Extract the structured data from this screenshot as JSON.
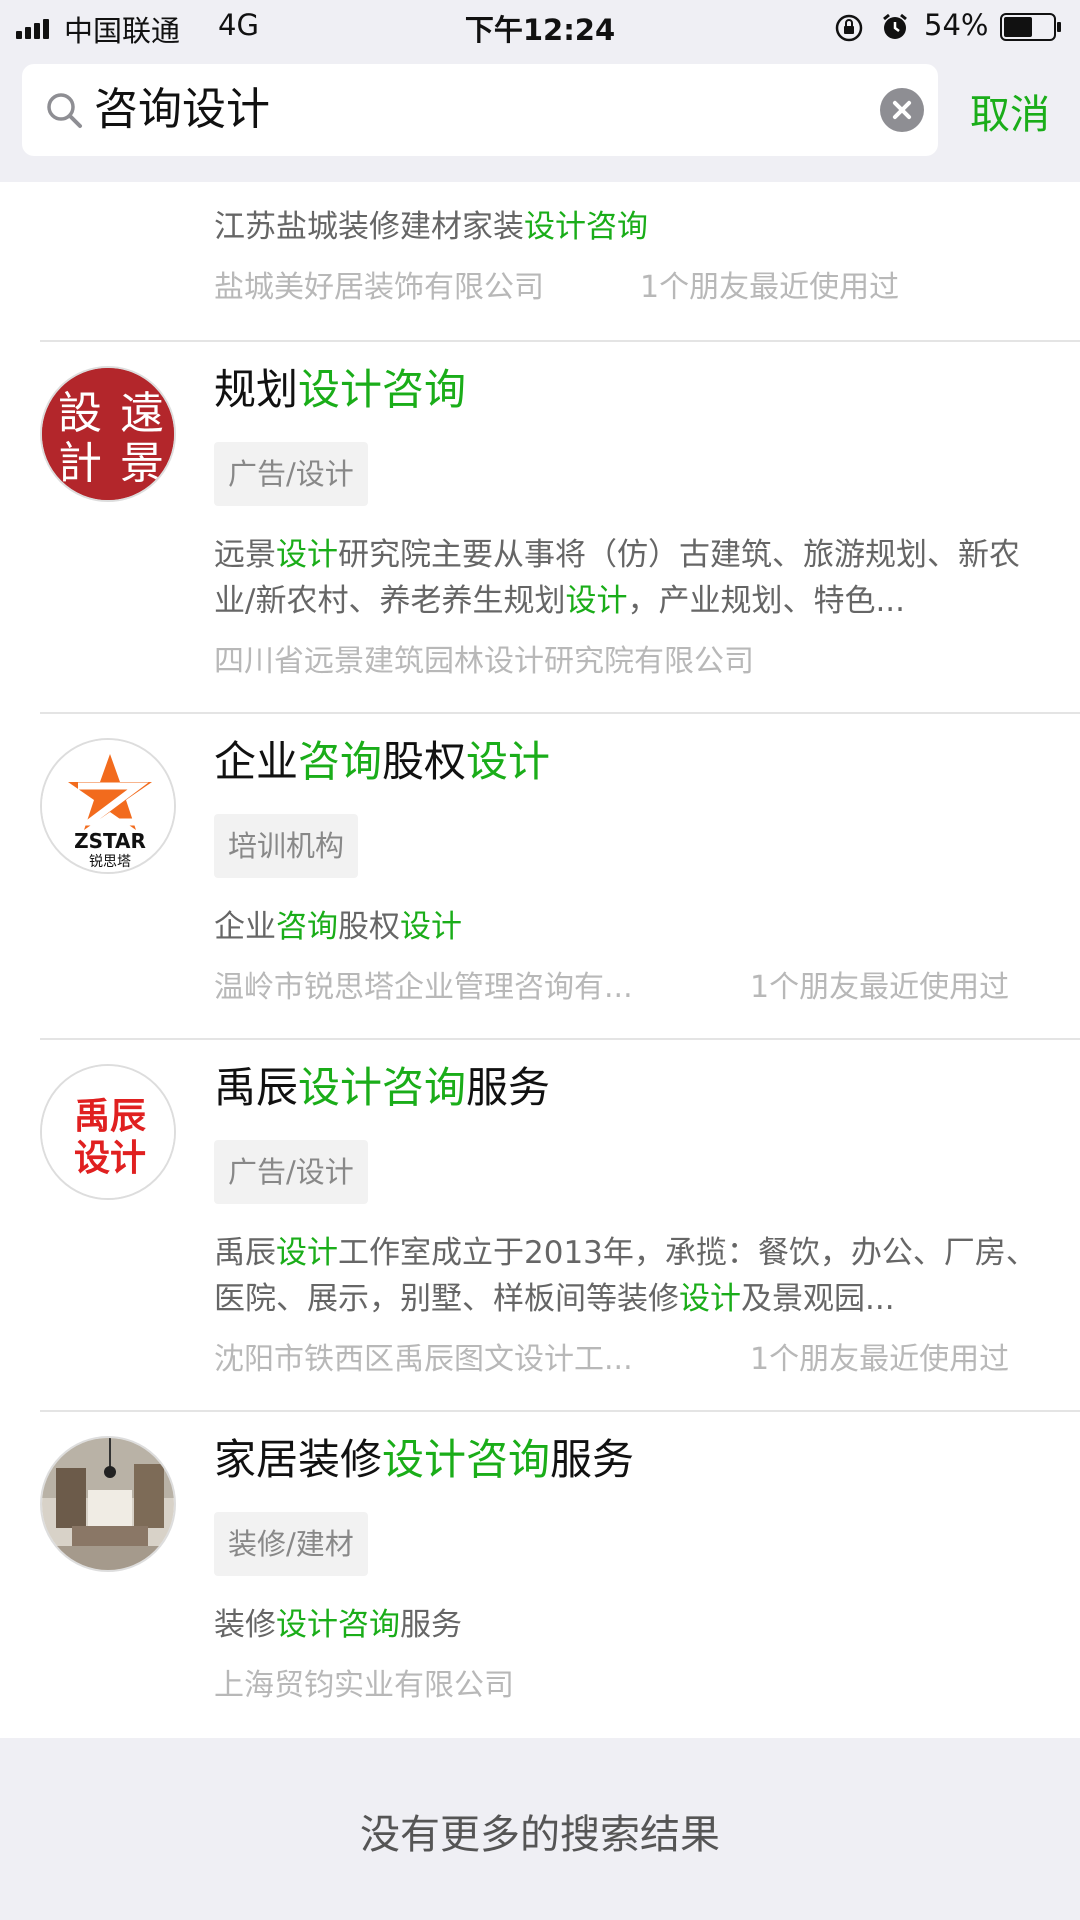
{
  "status_bar": {
    "carrier": "中国联通",
    "network": "4G",
    "time": "下午12:24",
    "battery": "54%"
  },
  "search": {
    "query": "咨询设计",
    "cancel_label": "取消"
  },
  "results": [
    {
      "title_parts": [],
      "tag": "",
      "desc_parts": [
        {
          "text": "江苏盐城装修建材家装"
        },
        {
          "text": "设计咨询",
          "hl": true
        }
      ],
      "company": "盐城美好居装饰有限公司",
      "friends": "1个朋友最近使用过"
    },
    {
      "title_parts": [
        {
          "text": "规划"
        },
        {
          "text": "设计咨询",
          "hl": true
        }
      ],
      "tag": "广告/设计",
      "avatar_chars": [
        "遠",
        "景",
        "設",
        "計"
      ],
      "desc_parts": [
        {
          "text": "远景"
        },
        {
          "text": "设计",
          "hl": true
        },
        {
          "text": "研究院主要从事将（仿）古建筑、旅游规划、新农业/新农村、养老养生规划"
        },
        {
          "text": "设计",
          "hl": true
        },
        {
          "text": "，产业规划、特色..."
        }
      ],
      "company": "四川省远景建筑园林设计研究院有限公司",
      "friends": ""
    },
    {
      "title_parts": [
        {
          "text": "企业"
        },
        {
          "text": "咨询",
          "hl": true
        },
        {
          "text": "股权"
        },
        {
          "text": "设计",
          "hl": true
        }
      ],
      "tag": "培训机构",
      "avatar_text": "ZSTAR",
      "avatar_sub": "锐思塔",
      "desc_parts": [
        {
          "text": "企业"
        },
        {
          "text": "咨询",
          "hl": true
        },
        {
          "text": "股权"
        },
        {
          "text": "设计",
          "hl": true
        }
      ],
      "company": "温岭市锐思塔企业管理咨询有...",
      "friends": "1个朋友最近使用过"
    },
    {
      "title_parts": [
        {
          "text": "禹辰"
        },
        {
          "text": "设计咨询",
          "hl": true
        },
        {
          "text": "服务"
        }
      ],
      "tag": "广告/设计",
      "avatar_lines": [
        "禹辰",
        "设计"
      ],
      "desc_parts": [
        {
          "text": "禹辰"
        },
        {
          "text": "设计",
          "hl": true
        },
        {
          "text": "工作室成立于2013年，承揽：餐饮，办公、厂房、医院、展示，别墅、样板间等装修"
        },
        {
          "text": "设计",
          "hl": true
        },
        {
          "text": "及景观园..."
        }
      ],
      "company": "沈阳市铁西区禹辰图文设计工...",
      "friends": "1个朋友最近使用过"
    },
    {
      "title_parts": [
        {
          "text": "家居装修"
        },
        {
          "text": "设计咨询",
          "hl": true
        },
        {
          "text": "服务"
        }
      ],
      "tag": "装修/建材",
      "desc_parts": [
        {
          "text": "装修"
        },
        {
          "text": "设计咨询",
          "hl": true
        },
        {
          "text": "服务"
        }
      ],
      "company": "上海贸钧实业有限公司",
      "friends": ""
    }
  ],
  "footer": {
    "no_more": "没有更多的搜索结果"
  },
  "colors": {
    "accent": "#1aad19",
    "seal_red": "#b3262b",
    "logo_orange": "#f26b1d",
    "logo_red": "#e02020"
  }
}
